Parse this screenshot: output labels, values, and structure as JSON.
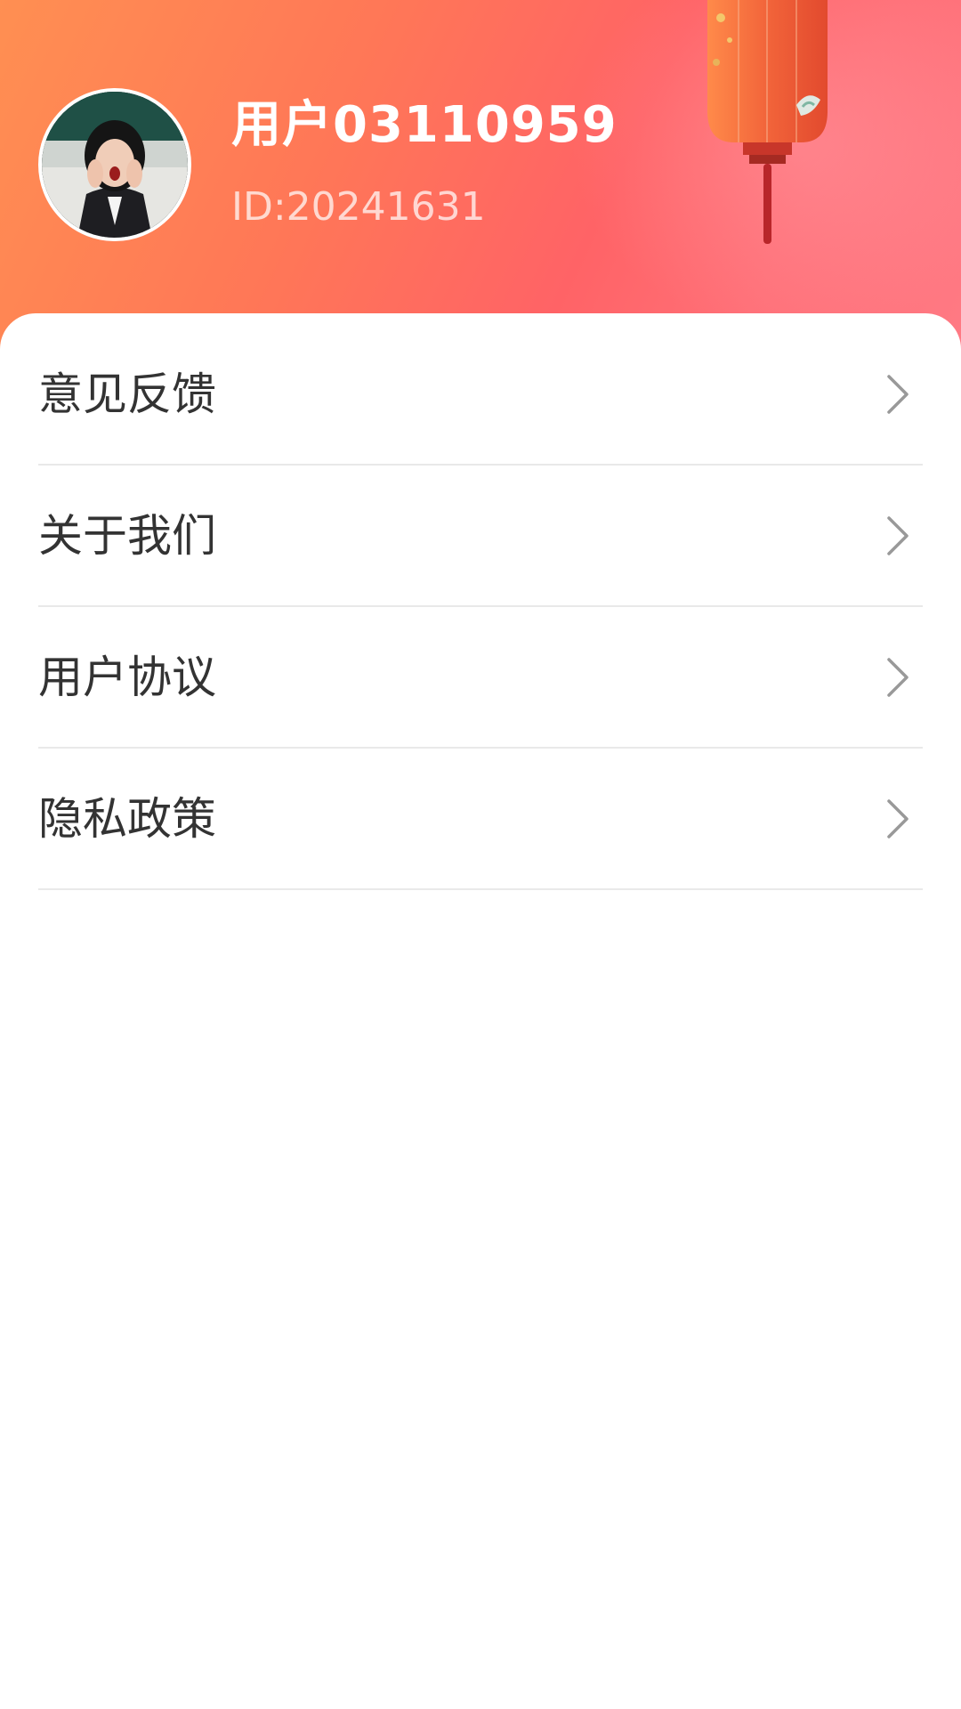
{
  "profile": {
    "username": "用户03110959",
    "user_id": "ID:20241631",
    "avatar_icon": "user-avatar-photo"
  },
  "menu": {
    "items": [
      {
        "label": "意见反馈",
        "icon": "chevron-right-icon"
      },
      {
        "label": "关于我们",
        "icon": "chevron-right-icon"
      },
      {
        "label": "用户协议",
        "icon": "chevron-right-icon"
      },
      {
        "label": "隐私政策",
        "icon": "chevron-right-icon"
      }
    ]
  },
  "colors": {
    "header_gradient_start": "#ff8f52",
    "header_gradient_end": "#ff6366",
    "text_primary": "#333333",
    "divider": "#e9e9e9",
    "chevron": "#999999"
  }
}
